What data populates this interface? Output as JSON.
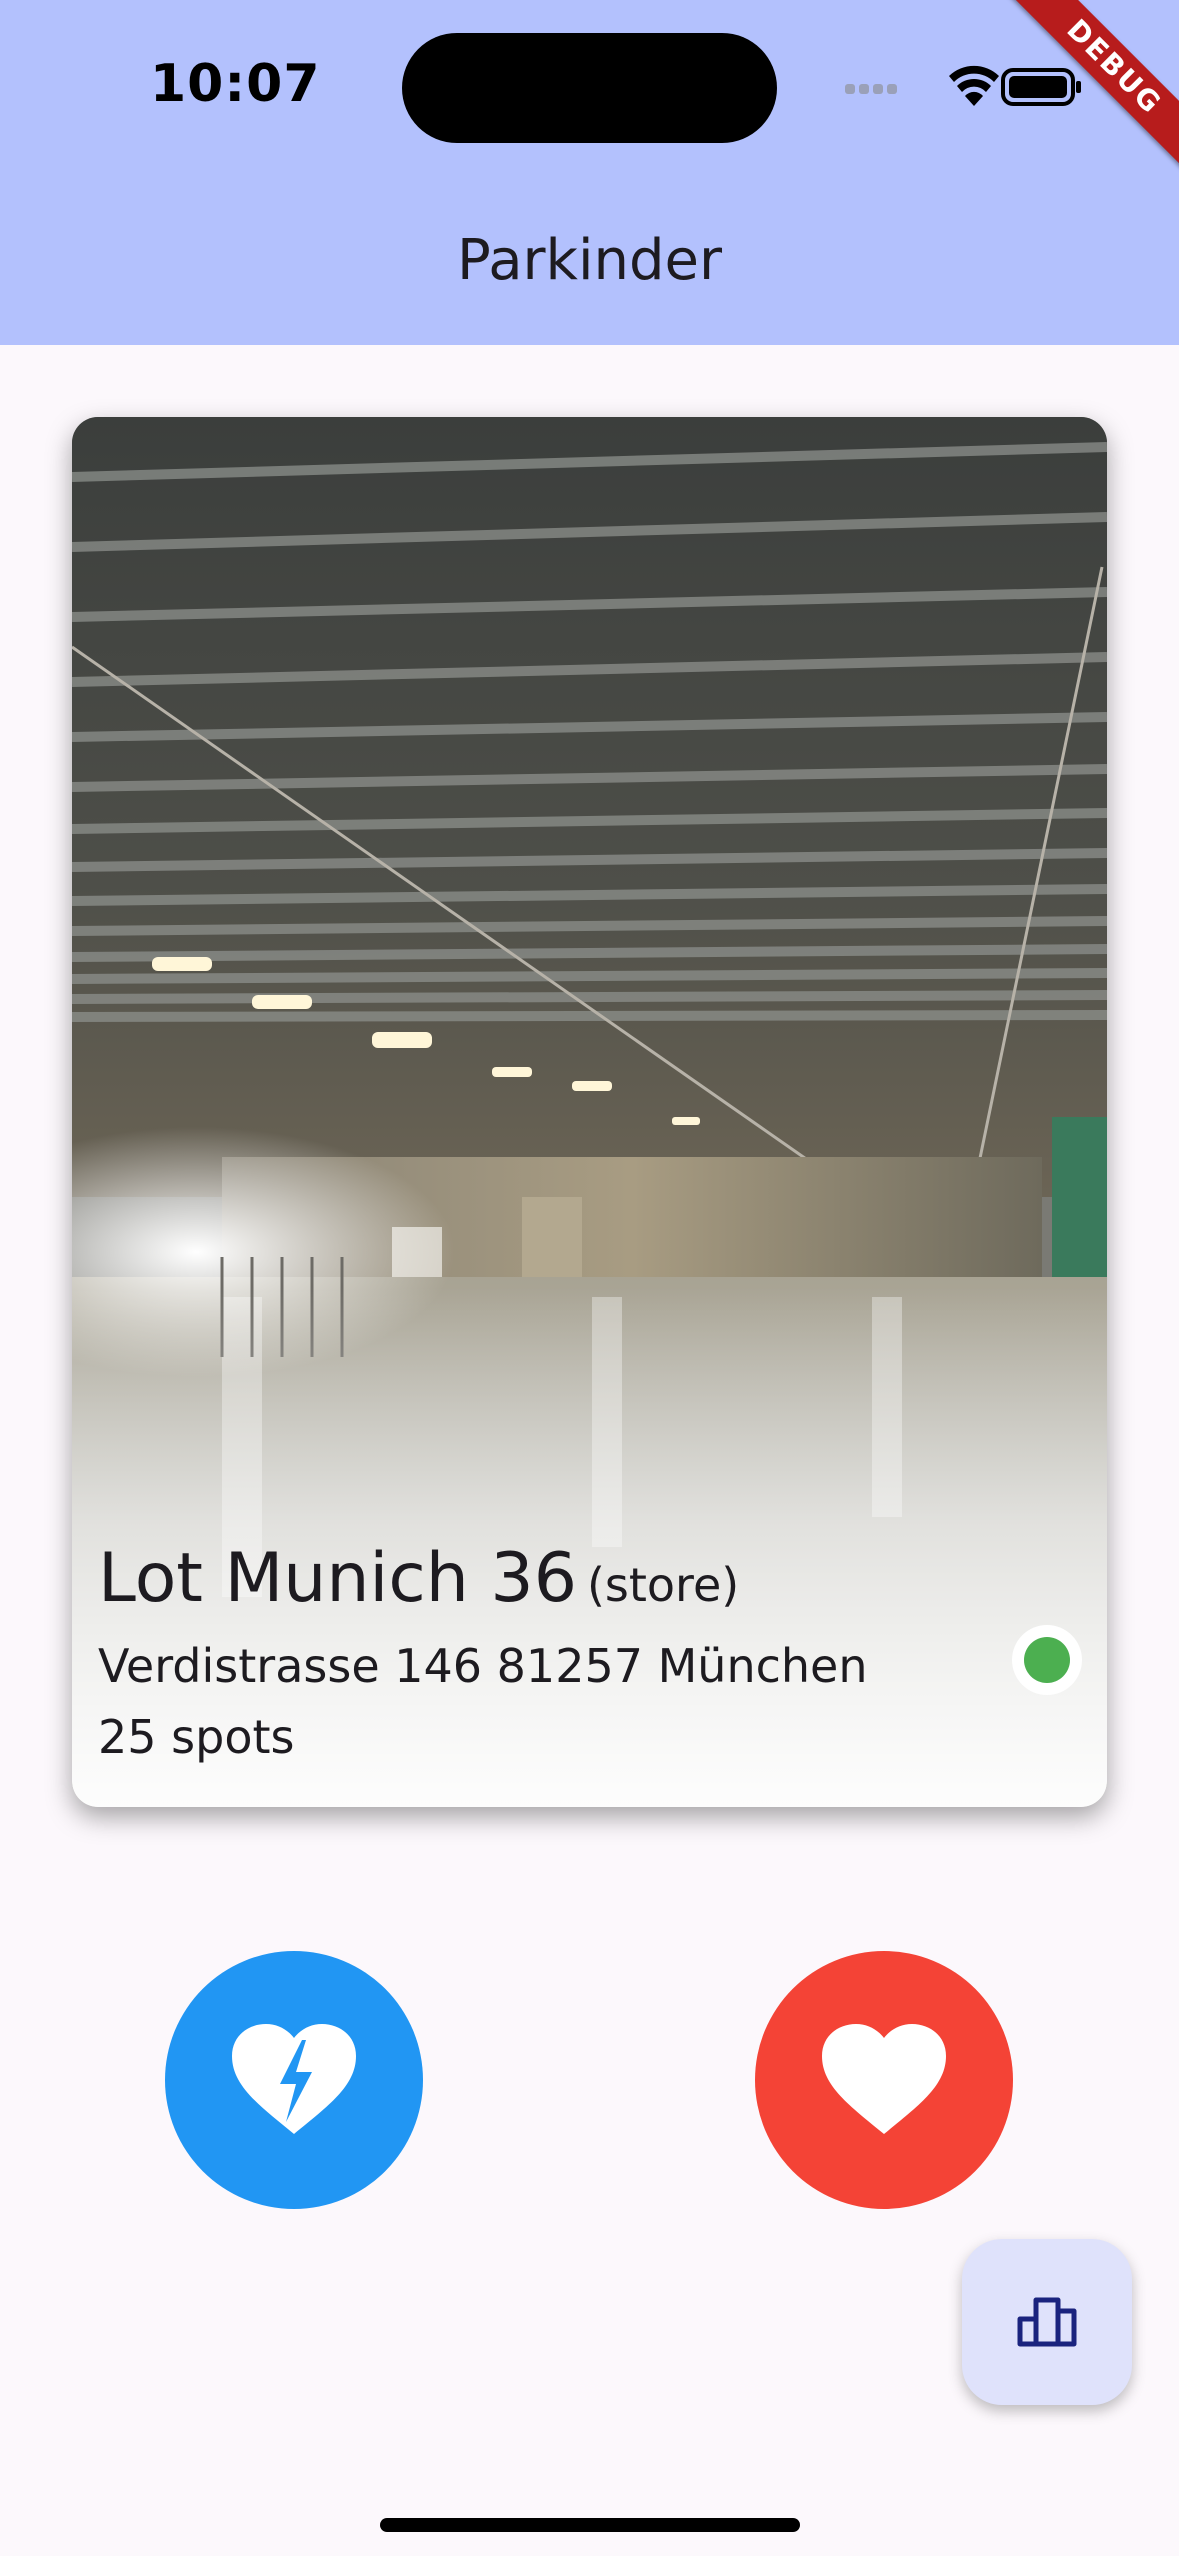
{
  "status_bar": {
    "time": "10:07",
    "wifi_icon": "wifi-icon",
    "battery_icon": "battery-icon"
  },
  "debug_banner": {
    "label": "DEBUG"
  },
  "app_bar": {
    "title": "Parkinder"
  },
  "card": {
    "image_icon": "parking-garage-photo",
    "name": "Lot Munich 36",
    "type": "(store)",
    "address": "Verdistrasse 146 81257 München",
    "spots": "25 spots",
    "status_color": "#4caf50"
  },
  "actions": {
    "dislike_icon": "broken-heart-icon",
    "dislike_color": "#2196f3",
    "like_icon": "heart-icon",
    "like_color": "#f44336"
  },
  "fab": {
    "icon": "leaderboard-icon"
  }
}
